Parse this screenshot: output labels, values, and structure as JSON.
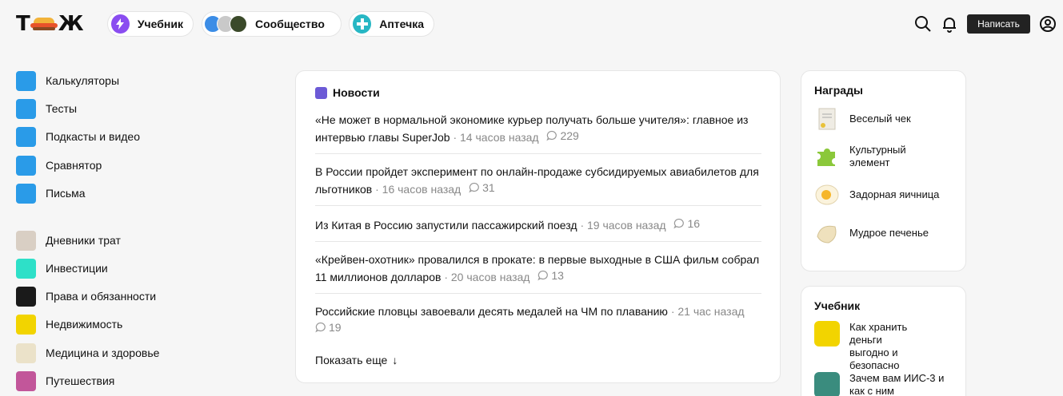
{
  "header": {
    "logo": "ТЖ",
    "pills": {
      "study": "Учебник",
      "community": "Сообщество",
      "aid": "Аптечка"
    },
    "write_label": "Написать"
  },
  "sidebar": {
    "group1": [
      "Калькуляторы",
      "Тесты",
      "Подкасты и видео",
      "Сравнятор",
      "Письма"
    ],
    "group2": [
      "Дневники трат",
      "Инвестиции",
      "Права и обязанности",
      "Недвижимость",
      "Медицина и здоровье",
      "Путешествия"
    ]
  },
  "news": {
    "title": "Новости",
    "items": [
      {
        "text": "«Не может в нормальной экономике курьер получать больше учителя»: главное из интервью главы SuperJob",
        "time": "· 14 часов назад",
        "comments": "229"
      },
      {
        "text": "В России пройдет эксперимент по онлайн-продаже субсидируемых авиабилетов для льготников",
        "time": "· 16 часов назад",
        "comments": "31"
      },
      {
        "text": "Из Китая в Россию запустили пассажирский поезд",
        "time": "· 19 часов назад",
        "comments": "16"
      },
      {
        "text": "«Крейвен-охотник» провалился в прокате: в первые выходные в США фильм собрал 11 миллионов долларов",
        "time": "· 20 часов назад",
        "comments": "13"
      },
      {
        "text": "Российские пловцы завоевали десять медалей на ЧМ по плаванию",
        "time": "· 21 час назад",
        "comments": "19"
      }
    ],
    "more_label": "Показать еще",
    "more_arrow": "↓"
  },
  "awards": {
    "title": "Награды",
    "items": [
      "Веселый чек",
      "Культурный элемент",
      "Задорная яичница",
      "Мудрое печенье"
    ]
  },
  "textbook": {
    "title": "Учебник",
    "items": [
      "Как хранить деньги выгодно и безопасно",
      "Зачем вам ИИС-3 и как с ним"
    ]
  }
}
